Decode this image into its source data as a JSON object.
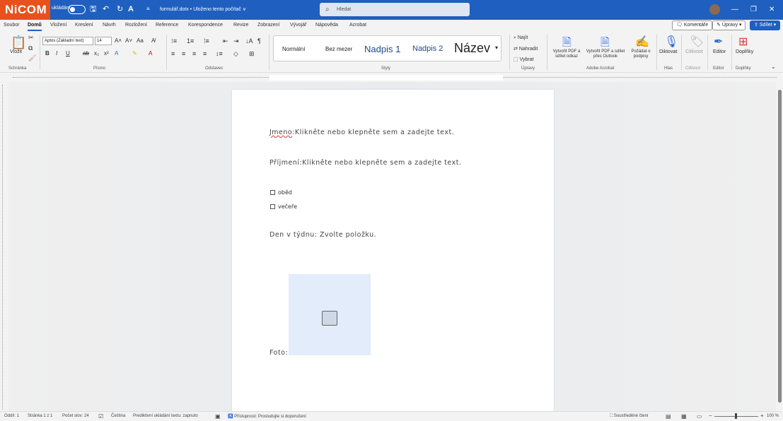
{
  "titlebar": {
    "logo": "NiCOM",
    "autosave_label": "ukládání",
    "document_title": "formulář.dotx • Uloženo tento počítač ∨",
    "search_placeholder": "Hledat"
  },
  "menu": {
    "items": [
      "Soubor",
      "Domů",
      "Vložení",
      "Kreslení",
      "Návrh",
      "Rozložení",
      "Reference",
      "Korespondence",
      "Revize",
      "Zobrazení",
      "Vývojář",
      "Nápověda",
      "Acrobat"
    ],
    "active": "Domů",
    "comments_button": "Komentáře",
    "edit_button": "Úpravy",
    "share_button": "Sdílet"
  },
  "ribbon": {
    "paste_label": "Vložit",
    "clipboard_group": "Schránka",
    "font_name": "Aptos (Základní text)",
    "font_size": "14",
    "font_group": "Písmo",
    "paragraph_group": "Odstavec",
    "styles_group": "Styly",
    "styles": [
      "Normální",
      "Bez mezer",
      "Nadpis 1",
      "Nadpis 2",
      "Název"
    ],
    "find_label": "Najít",
    "replace_label": "Nahradit",
    "select_label": "Vybrat",
    "editing_group": "Úpravy",
    "pdf_share_label": "Vytvořit PDF a sdílet odkaz",
    "pdf_outlook_label": "Vytvořit PDF a sdílet přes Outlook",
    "request_sign_label": "Požádat o podpisy",
    "acrobat_group": "Adobe Acrobat",
    "dictate_label": "Diktovat",
    "voice_group": "Hlas",
    "sensitivity_label": "Citlivost",
    "editor_label": "Editor",
    "addins_label": "Doplňky"
  },
  "document": {
    "name_label": "Jmeno",
    "name_placeholder": ":Klikněte nebo klepněte sem a zadejte text.",
    "surname_line": "Příjmení:Klikněte nebo klepněte sem a zadejte text.",
    "checkbox_1": "oběd",
    "checkbox_2": "večeře",
    "weekday_line": "Den v týdnu: Zvolte položku.",
    "photo_label": "Foto:"
  },
  "status": {
    "section": "Oddíl: 1",
    "page": "Stránka 1 z 1",
    "words": "Počet slov: 24",
    "language": "Čeština",
    "predictive": "Prediktivní ukládání textu: zapnuto",
    "accessibility": "Přístupnost: Prostudujte si doporučení",
    "focus": "Soustředěné čtení",
    "zoom": "100 %"
  }
}
